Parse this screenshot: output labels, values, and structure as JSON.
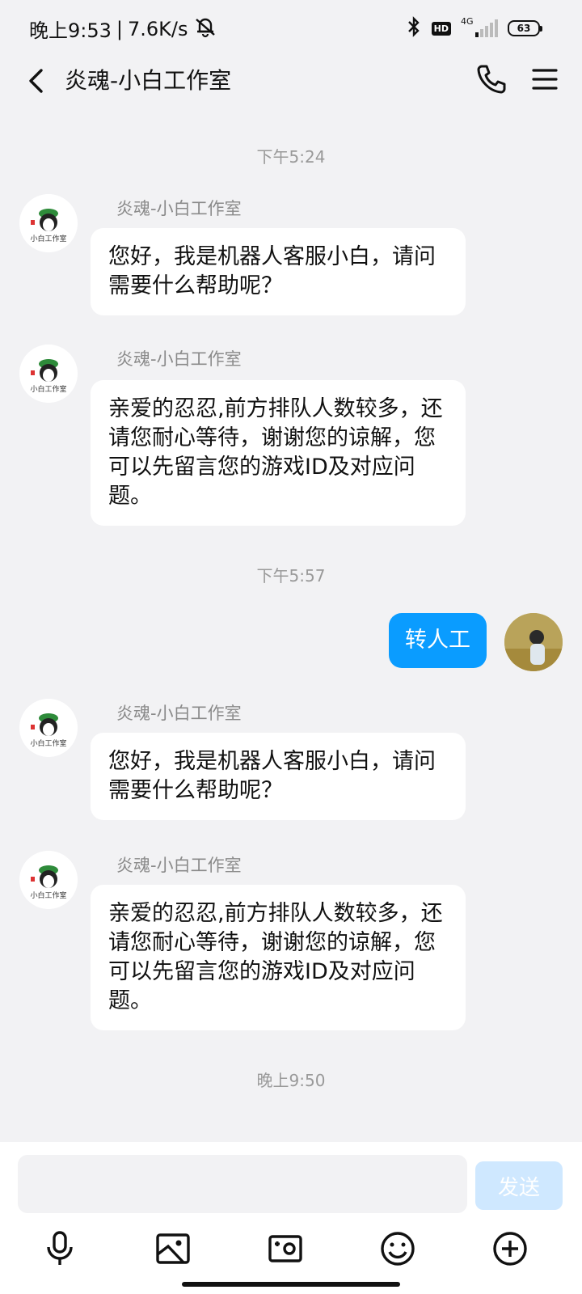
{
  "status": {
    "time": "晚上9:53",
    "speed": "7.6K/s",
    "net": "4G",
    "battery": "63",
    "hd": "HD"
  },
  "header": {
    "title": "炎魂-小白工作室"
  },
  "messages": {
    "t1": "下午5:24",
    "m1": {
      "sender": "炎魂-小白工作室",
      "text": "您好，我是机器人客服小白，请问需要什么帮助呢？"
    },
    "m2": {
      "sender": "炎魂-小白工作室",
      "text": "亲爱的忍忍,前方排队人数较多，还请您耐心等待，谢谢您的谅解，您可以先留言您的游戏ID及对应问题。"
    },
    "t2": "下午5:57",
    "m3": {
      "text": "转人工"
    },
    "m4": {
      "sender": "炎魂-小白工作室",
      "text": "您好，我是机器人客服小白，请问需要什么帮助呢？"
    },
    "m5": {
      "sender": "炎魂-小白工作室",
      "text": "亲爱的忍忍,前方排队人数较多，还请您耐心等待，谢谢您的谅解，您可以先留言您的游戏ID及对应问题。"
    },
    "t3": "晚上9:50"
  },
  "avatar_text": "小白工作室",
  "input": {
    "placeholder": "",
    "send_label": "发送"
  },
  "colors": {
    "accent": "#0a9cff",
    "send_disabled": "#cfe8ff"
  }
}
